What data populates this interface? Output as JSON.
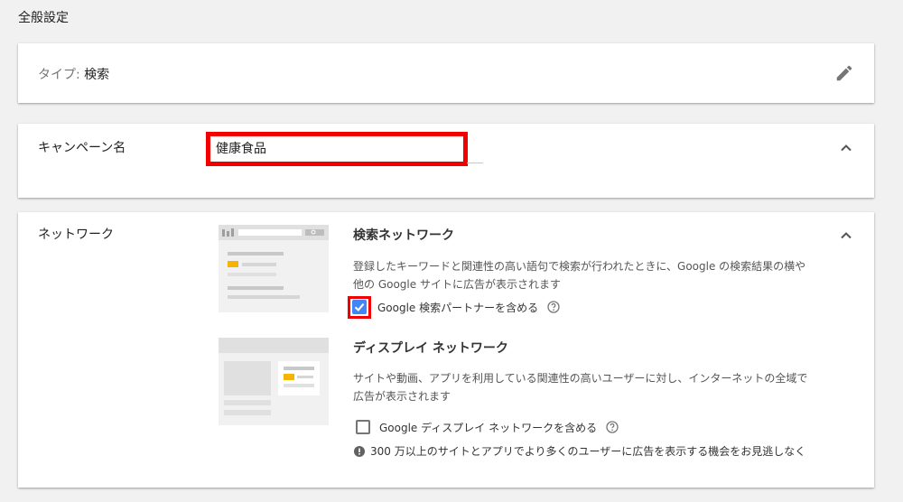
{
  "page": {
    "title": "全般設定"
  },
  "type_card": {
    "prefix": "タイプ:",
    "value": "検索"
  },
  "name_card": {
    "label": "キャンペーン名",
    "input_value": "健康食品"
  },
  "network_card": {
    "label": "ネットワーク",
    "search": {
      "title": "検索ネットワーク",
      "description": "登録したキーワードと関連性の高い語句で検索が行われたときに、Google の検索結果の横や他の Google サイトに広告が表示されます",
      "checkbox_label": "Google 検索パートナーを含める",
      "checked": true
    },
    "display": {
      "title": "ディスプレイ ネットワーク",
      "description": "サイトや動画、アプリを利用している関連性の高いユーザーに対し、インターネットの全域で広告が表示されます",
      "checkbox_label": "Google ディスプレイ ネットワークを含める",
      "checked": false,
      "warning": "300 万以上のサイトとアプリでより多くのユーザーに広告を表示する機会をお見逃しなく"
    }
  },
  "colors": {
    "accent": "#4285f4",
    "highlight": "#f20000",
    "yellow": "#f4b400"
  }
}
